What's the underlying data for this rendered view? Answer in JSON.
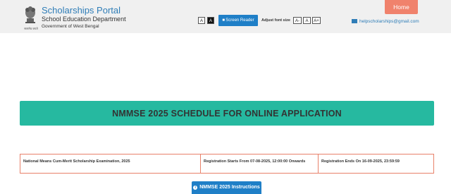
{
  "header": {
    "portal_title": "Scholarships Portal",
    "department": "School Education Department",
    "government": "Government of West Bengal",
    "emblem_caption": "सत्यमेव जयते",
    "font_buttons": {
      "a_normal": "A",
      "a_contrast": "A",
      "a_minus": "A-",
      "a_reset": "A",
      "a_plus": "A+"
    },
    "screen_reader_label": "Screen Reader",
    "adjust_font_label": "Adjust font size",
    "home_label": "Home",
    "email": "helpscholarships@gmail.com"
  },
  "banner": {
    "title": "NMMSE 2025 SCHEDULE FOR ONLINE APPLICATION"
  },
  "schedule": {
    "exam_name": "National Means Cum-Merit Scholarship Examination, 2025",
    "registration_start": "Registration Starts From 07-08-2025, 12:00:00 Onwards",
    "registration_end": "Registration Ends On 16-09-2025, 23:59:59"
  },
  "instructions_button": "NMMSE 2025 Instructions",
  "colors": {
    "brand_blue": "#1f7fc7",
    "banner_teal": "#26b9a0",
    "home_salmon": "#f0826c",
    "table_border": "#e8816a"
  }
}
